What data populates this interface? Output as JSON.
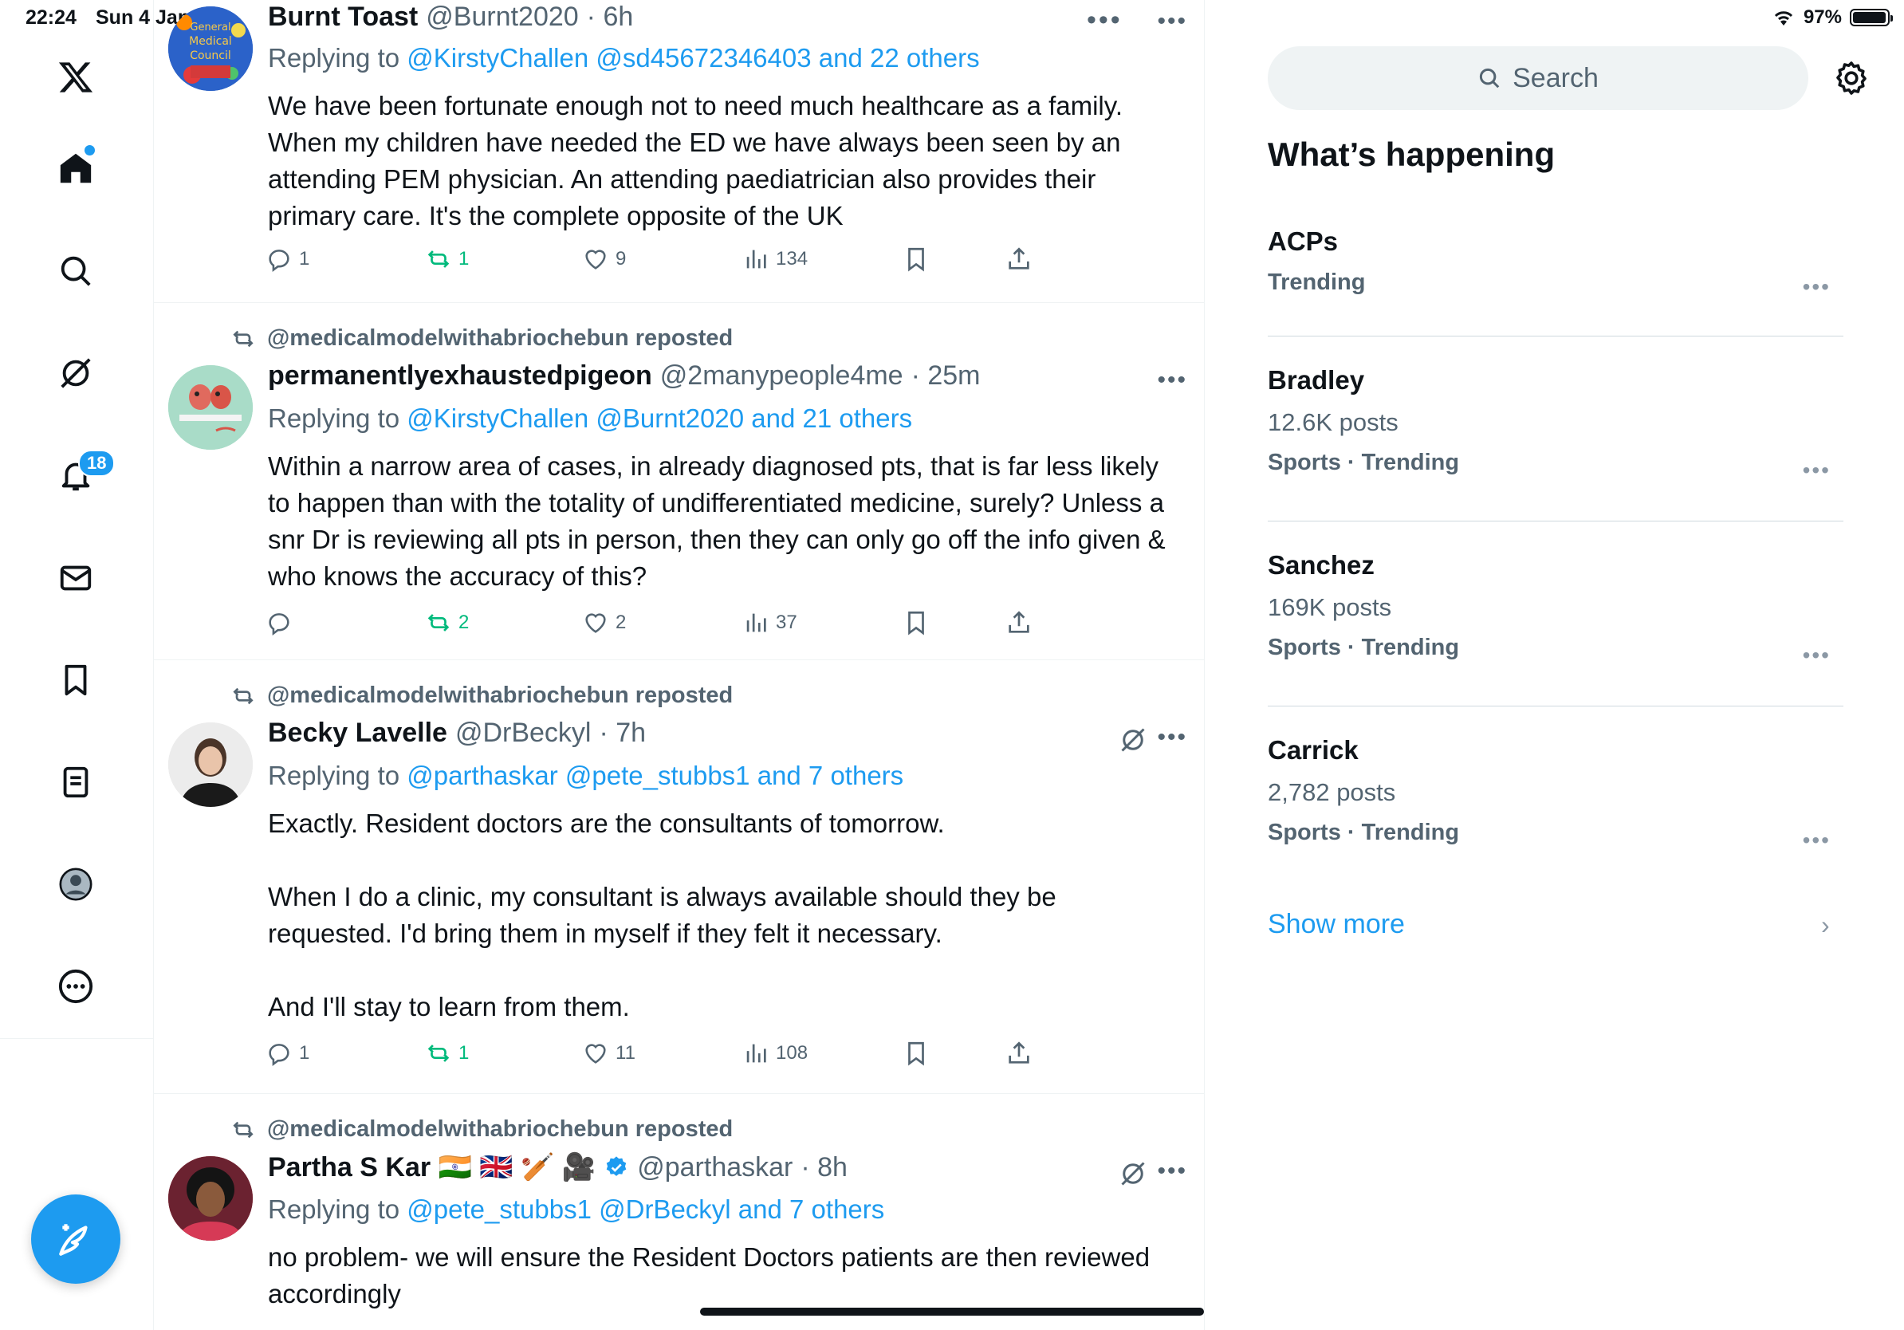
{
  "status_bar": {
    "time": "22:24",
    "date": "Sun 4 Jan",
    "battery": "97%",
    "battery_level": 0.97
  },
  "nav": {
    "items": [
      "x-logo",
      "home",
      "explore",
      "grok",
      "notifications",
      "messages",
      "bookmarks",
      "lists",
      "profile",
      "more"
    ],
    "notifications_count": "18"
  },
  "top_more": "•••",
  "tweets": [
    {
      "name": "Burnt Toast",
      "handle": "@Burnt2020",
      "time": "· 6h",
      "reply_prefix": "Replying to",
      "reply_links": "@KirstyChallen @sd45672346403 and 22 others",
      "text": "We have been fortunate enough not to need much healthcare as a family. When my children have needed the ED we have always been seen by an attending PEM physician. An attending paediatrician also provides their primary care. It's the complete opposite of the UK",
      "replies": "1",
      "reposts": "1",
      "likes": "9",
      "views": "134",
      "avatar_text": "General Medical Council"
    },
    {
      "repost_by": "@medicalmodelwithabriochebun reposted",
      "name": "permanentlyexhaustedpigeon",
      "handle": "@2manypeople4me",
      "time": "· 25m",
      "reply_prefix": "Replying to",
      "reply_links": "@KirstyChallen @Burnt2020 and 21 others",
      "text": "Within a narrow area of cases, in already diagnosed pts, that is far less likely to happen than with the totality of undifferentiated medicine, surely? Unless a snr Dr is reviewing all pts in person, then they can only go off the info given & who knows the accuracy of this?",
      "replies": "",
      "reposts": "2",
      "likes": "2",
      "views": "37"
    },
    {
      "repost_by": "@medicalmodelwithabriochebun reposted",
      "name": "Becky Lavelle",
      "handle": "@DrBeckyl",
      "time": "· 7h",
      "reply_prefix": "Replying to",
      "reply_links": "@parthaskar @pete_stubbs1 and 7 others",
      "text": "Exactly. Resident doctors are the consultants of tomorrow.\n\nWhen I do a clinic, my consultant is always available should they be requested. I'd bring them in myself if they felt it necessary.\n\nAnd I'll stay to learn from them.",
      "replies": "1",
      "reposts": "1",
      "likes": "11",
      "views": "108"
    },
    {
      "repost_by": "@medicalmodelwithabriochebun reposted",
      "name": "Partha S Kar 🇮🇳 🇬🇧 🏏 🎥",
      "handle": "@parthaskar",
      "time": "· 8h",
      "reply_prefix": "Replying to",
      "reply_links": "@pete_stubbs1 @DrBeckyl and 7 others",
      "text": "no problem- we will ensure the Resident Doctors patients are then reviewed accordingly"
    }
  ],
  "sidebar": {
    "search_placeholder": "Search",
    "trends_title": "What’s happening",
    "trends": [
      {
        "name": "ACPs",
        "posts": "",
        "category": "Trending"
      },
      {
        "name": "Bradley",
        "posts": "12.6K posts",
        "category": "Sports · Trending"
      },
      {
        "name": "Sanchez",
        "posts": "169K posts",
        "category": "Sports · Trending"
      },
      {
        "name": "Carrick",
        "posts": "2,782 posts",
        "category": "Sports · Trending"
      }
    ],
    "show_more": "Show more"
  },
  "colors": {
    "accent": "#1d9bf0",
    "repost_green": "#00ba7c",
    "text": "#0f1419",
    "muted": "#536471"
  }
}
